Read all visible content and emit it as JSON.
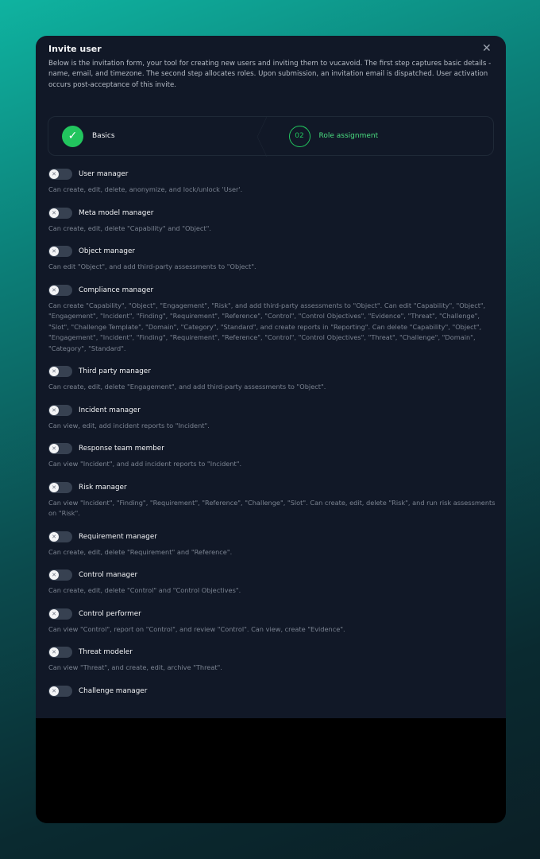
{
  "modal": {
    "title": "Invite user",
    "close_icon": "close-icon",
    "intro": "Below is the invitation form, your tool for creating new users and inviting them to vucavoid. The first step captures basic details - name, email, and timezone. The second step allocates roles. Upon submission, an invitation email is dispatched. User activation occurs post-acceptance of this invite."
  },
  "steps": [
    {
      "label": "Basics",
      "status": "complete",
      "icon": "check-icon"
    },
    {
      "number": "02",
      "label": "Role assignment",
      "status": "current"
    }
  ],
  "colors": {
    "accent": "#22c55e",
    "background": "#111827"
  },
  "roles": [
    {
      "name": "User manager",
      "enabled": false,
      "description": "Can create, edit, delete, anonymize, and lock/unlock 'User'."
    },
    {
      "name": "Meta model manager",
      "enabled": false,
      "description": "Can create, edit, delete \"Capability\" and \"Object\"."
    },
    {
      "name": "Object manager",
      "enabled": false,
      "description": "Can edit \"Object\", and add third-party assessments to \"Object\"."
    },
    {
      "name": "Compliance manager",
      "enabled": false,
      "description": "Can create \"Capability\", \"Object\", \"Engagement\", \"Risk\", and add third-party assessments to \"Object\". Can edit \"Capability\", \"Object\", \"Engagement\", \"Incident\", \"Finding\", \"Requirement\", \"Reference\", \"Control\", \"Control Objectives\", \"Evidence\", \"Threat\", \"Challenge\", \"Slot\", \"Challenge Template\", \"Domain\", \"Category\", \"Standard\", and create reports in \"Reporting\". Can delete \"Capability\", \"Object\", \"Engagement\", \"Incident\", \"Finding\", \"Requirement\", \"Reference\", \"Control\", \"Control Objectives\", \"Threat\", \"Challenge\", \"Domain\", \"Category\", \"Standard\"."
    },
    {
      "name": "Third party manager",
      "enabled": false,
      "description": "Can create, edit, delete \"Engagement\", and add third-party assessments to \"Object\"."
    },
    {
      "name": "Incident manager",
      "enabled": false,
      "description": "Can view, edit, add incident reports to \"Incident\"."
    },
    {
      "name": "Response team member",
      "enabled": false,
      "description": "Can view \"Incident\", and add incident reports to \"Incident\"."
    },
    {
      "name": "Risk manager",
      "enabled": false,
      "description": "Can view \"Incident\", \"Finding\", \"Requirement\", \"Reference\", \"Challenge\", \"Slot\". Can create, edit, delete \"Risk\", and run risk assessments on \"Risk\"."
    },
    {
      "name": "Requirement manager",
      "enabled": false,
      "description": "Can create, edit, delete \"Requirement\" and \"Reference\"."
    },
    {
      "name": "Control manager",
      "enabled": false,
      "description": "Can create, edit, delete \"Control\" and \"Control Objectives\"."
    },
    {
      "name": "Control performer",
      "enabled": false,
      "description": "Can view \"Control\", report on \"Control\", and review \"Control\". Can view, create \"Evidence\"."
    },
    {
      "name": "Threat modeler",
      "enabled": false,
      "description": "Can view \"Threat\", and create, edit, archive \"Threat\"."
    },
    {
      "name": "Challenge manager",
      "enabled": false
    }
  ]
}
